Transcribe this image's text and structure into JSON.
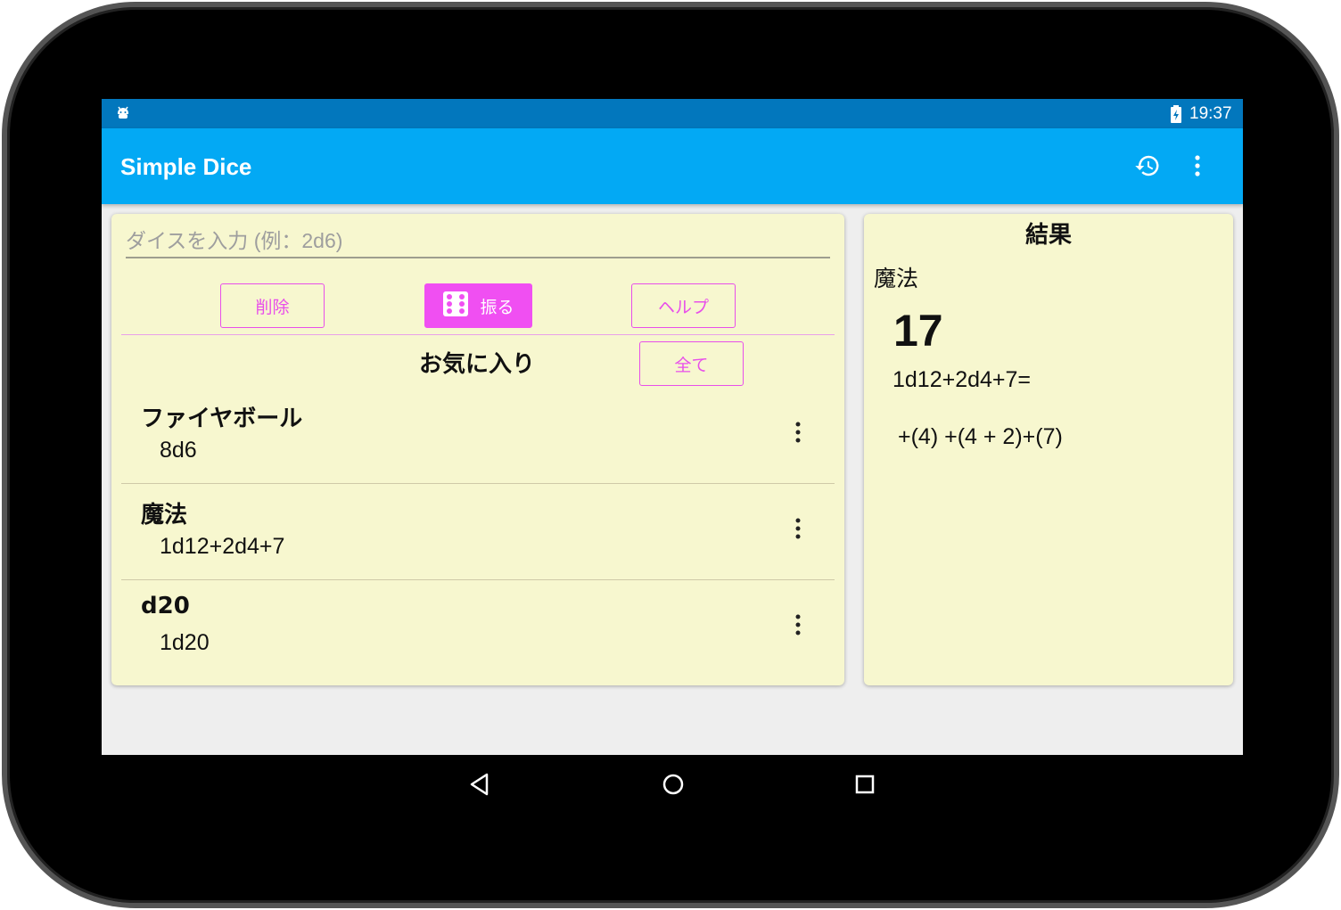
{
  "status_bar": {
    "time": "19:37",
    "left_icon": "android-debug-icon",
    "right_icon": "battery-charging-icon"
  },
  "app_bar": {
    "title": "Simple Dice",
    "actions": [
      "history-icon",
      "overflow-menu-icon"
    ]
  },
  "input": {
    "placeholder": "ダイスを入力 (例：2d6)",
    "value": ""
  },
  "buttons": {
    "delete": "削除",
    "roll": "振る",
    "help": "ヘルプ",
    "all": "全て"
  },
  "favorites": {
    "title": "お気に入り",
    "items": [
      {
        "name": "ファイヤボール",
        "formula": "8d6"
      },
      {
        "name": "魔法",
        "formula": "1d12+2d4+7"
      },
      {
        "name": "d20",
        "formula": "1d20"
      }
    ]
  },
  "result": {
    "heading": "結果",
    "name": "魔法",
    "total": "17",
    "expression": "1d12+2d4+7=",
    "breakdown": "+(4) +(4 + 2)+(7)"
  },
  "colors": {
    "status_bar": "#0277bd",
    "app_bar": "#03a9f4",
    "card": "#f7f7cf",
    "accent": "#f04ff2"
  },
  "nav_bar": [
    "back-icon",
    "home-icon",
    "recents-icon"
  ]
}
